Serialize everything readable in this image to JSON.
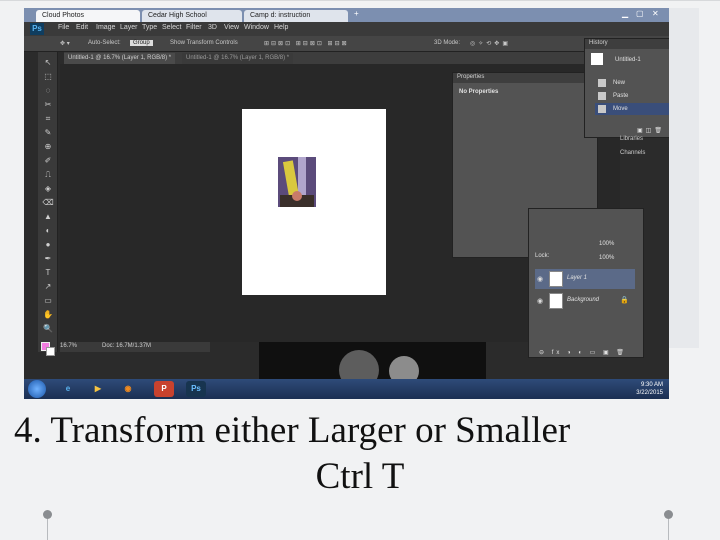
{
  "browser": {
    "tabs": [
      "Cloud Photos",
      "Cedar High School",
      "Camp d: instruction"
    ],
    "new_tab": "+"
  },
  "photoshop": {
    "logo": "Ps",
    "menus": [
      "File",
      "Edit",
      "Image",
      "Layer",
      "Type",
      "Select",
      "Filter",
      "3D",
      "View",
      "Window",
      "Help"
    ],
    "options": {
      "auto_select": "Auto-Select:",
      "auto_select_value": "Group",
      "transform_controls": "Show Transform Controls",
      "mode_3d": "3D Mode:"
    },
    "doc_tabs": [
      "Untitled-1 @ 16.7% (Layer 1, RGB/8) *",
      "Untitled-1 @ 16.7% (Layer 1, RGB/8) *"
    ],
    "tools": [
      "↖",
      "⬚",
      "◌",
      "✂",
      "⌗",
      "✎",
      "⊕",
      "✐",
      "⎍",
      "◈",
      "⌫",
      "▲",
      "◐",
      "●",
      "✒",
      "T",
      "↗",
      "▭",
      "✋",
      "🔍"
    ],
    "status": {
      "zoom": "16.7%",
      "doc_info": "Doc: 16.7M/1.37M"
    },
    "properties_panel": {
      "title": "Properties",
      "body": "No Properties"
    },
    "history_panel": {
      "title": "History",
      "doc_name": "Untitled-1",
      "items": [
        "New",
        "Paste",
        "Move"
      ]
    },
    "adjust_panel": {
      "items": [
        "Libraries",
        "Channels"
      ]
    },
    "layers_panel": {
      "lock_label": "Lock:",
      "opacity": "100%",
      "fill": "100%",
      "layers": [
        {
          "name": "Layer 1",
          "selected": true
        },
        {
          "name": "Background",
          "selected": false
        }
      ]
    }
  },
  "taskbar": {
    "time": "9:30 AM",
    "date": "3/22/2015",
    "apps": [
      "e",
      "▶",
      "◉",
      "P",
      "Ps"
    ]
  },
  "slide": {
    "caption_line1": "4. Transform either Larger or Smaller",
    "caption_line2": "Ctrl T"
  },
  "colors": {
    "ps_bg": "#2b2b2b",
    "panel": "#535353",
    "selection": "#3a4e7a",
    "foreground_swatch": "#f37ce0"
  }
}
